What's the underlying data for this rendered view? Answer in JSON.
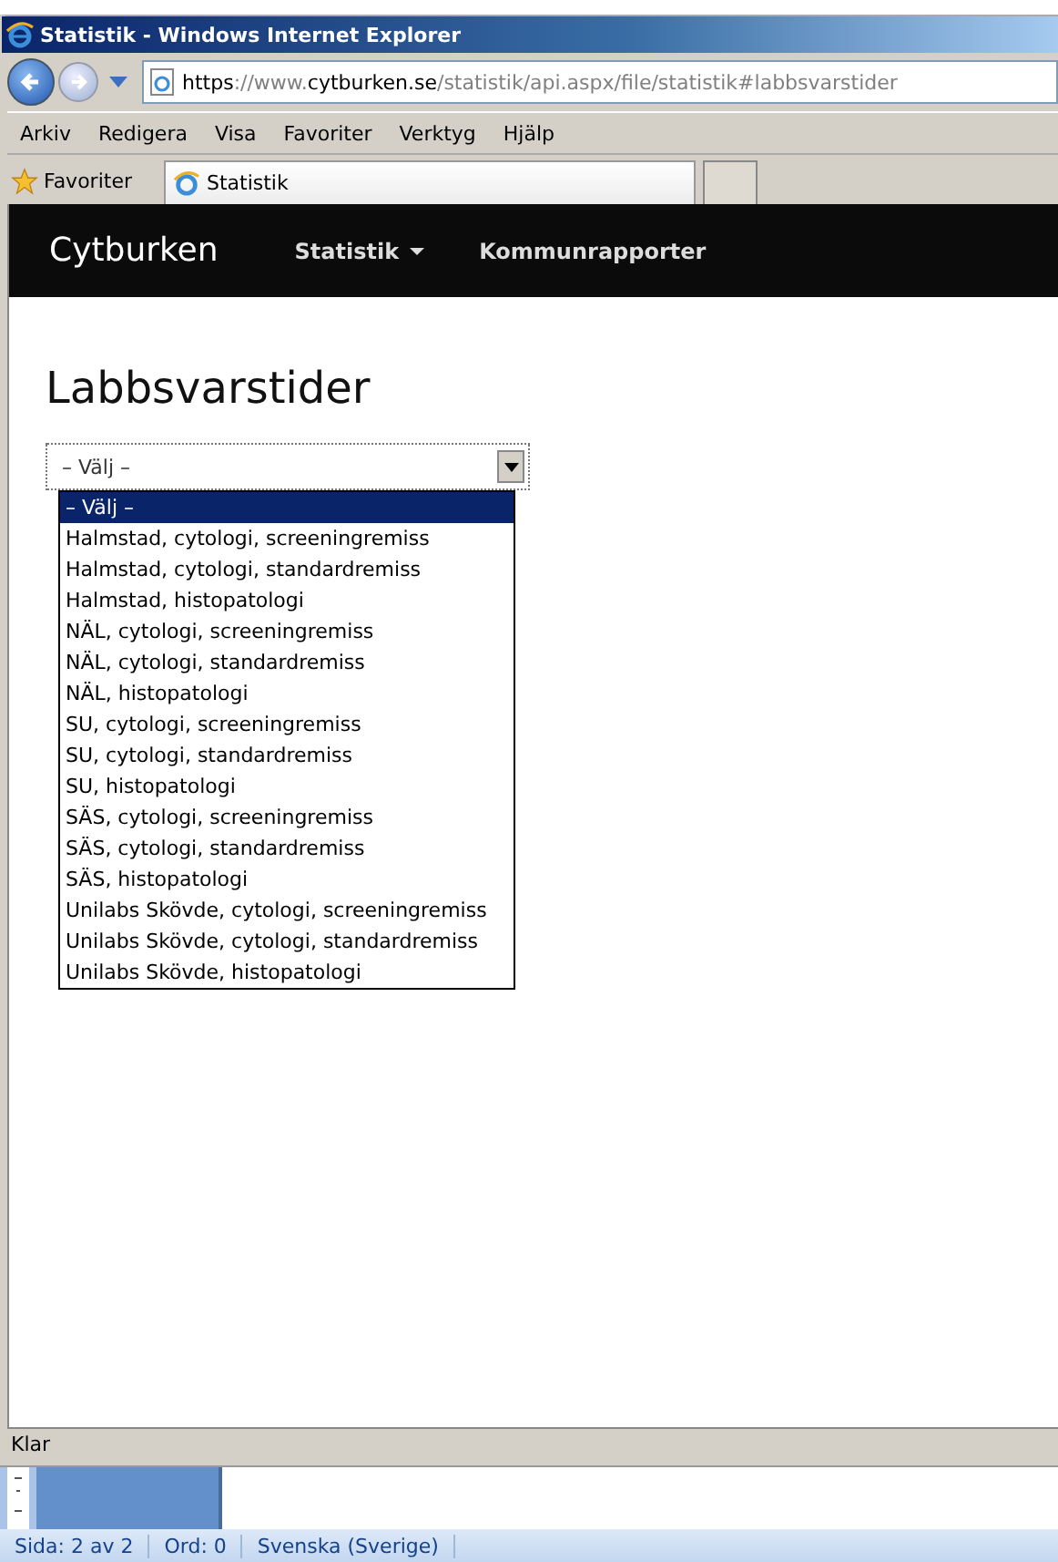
{
  "window": {
    "title": "Statistik - Windows Internet Explorer"
  },
  "address_bar": {
    "scheme": "https",
    "separator": "://www.",
    "domain": "cytburken.se",
    "path": "/statistik/api.aspx/file/statistik#labbsvarstider"
  },
  "menu": [
    "Arkiv",
    "Redigera",
    "Visa",
    "Favoriter",
    "Verktyg",
    "Hjälp"
  ],
  "favorites": {
    "label": "Favoriter"
  },
  "tabs": [
    {
      "label": "Statistik",
      "selected": true
    }
  ],
  "navbar": {
    "brand": "Cytburken",
    "items": [
      {
        "label": "Statistik",
        "dropdown": true
      },
      {
        "label": "Kommunrapporter",
        "dropdown": false
      }
    ]
  },
  "page": {
    "heading": "Labbsvarstider",
    "select": {
      "value": "– Välj –",
      "options": [
        {
          "label": "– Välj –",
          "selected": true
        },
        {
          "label": "Halmstad, cytologi, screeningremiss",
          "selected": false
        },
        {
          "label": "Halmstad, cytologi, standardremiss",
          "selected": false
        },
        {
          "label": "Halmstad, histopatologi",
          "selected": false
        },
        {
          "label": "NÄL, cytologi, screeningremiss",
          "selected": false
        },
        {
          "label": "NÄL, cytologi, standardremiss",
          "selected": false
        },
        {
          "label": "NÄL, histopatologi",
          "selected": false
        },
        {
          "label": "SU, cytologi, screeningremiss",
          "selected": false
        },
        {
          "label": "SU, cytologi, standardremiss",
          "selected": false
        },
        {
          "label": "SU, histopatologi",
          "selected": false
        },
        {
          "label": "SÄS, cytologi, screeningremiss",
          "selected": false
        },
        {
          "label": "SÄS, cytologi, standardremiss",
          "selected": false
        },
        {
          "label": "SÄS, histopatologi",
          "selected": false
        },
        {
          "label": "Unilabs Skövde, cytologi, screeningremiss",
          "selected": false
        },
        {
          "label": "Unilabs Skövde, cytologi, standardremiss",
          "selected": false
        },
        {
          "label": "Unilabs Skövde, histopatologi",
          "selected": false
        }
      ]
    }
  },
  "status_bar": {
    "text": "Klar"
  },
  "word_status_bar": [
    "Sida: 2 av 2",
    "Ord: 0",
    "Svenska (Sverige)"
  ]
}
